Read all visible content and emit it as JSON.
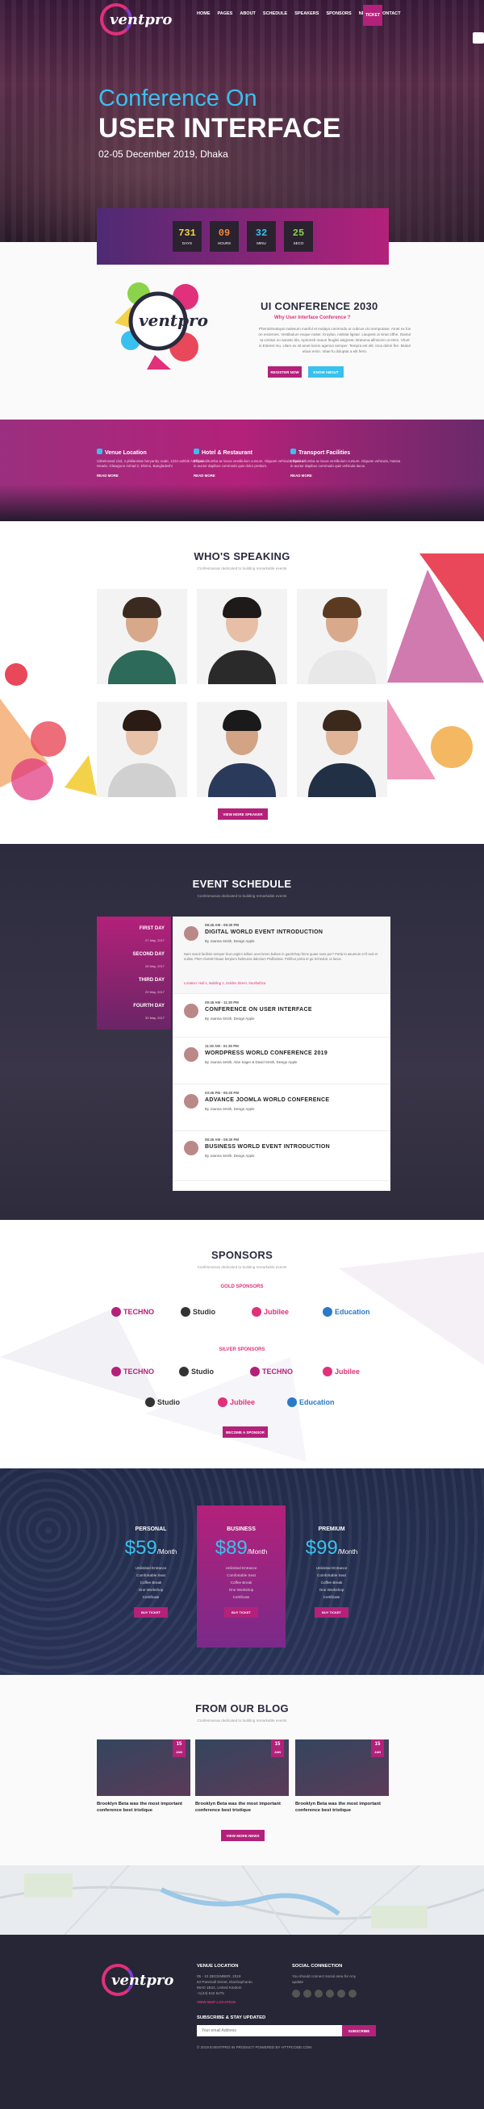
{
  "brand": {
    "logo_text": "ventpro"
  },
  "nav": {
    "items": [
      "HOME",
      "PAGES",
      "ABOUT",
      "SCHEDULE",
      "SPEAKERS",
      "SPONSORS",
      "NEWS",
      "CONTACT"
    ],
    "ticket_label": "TICKET"
  },
  "hero": {
    "line1": "Conference On",
    "line2": "USER INTERFACE",
    "line3": "02-05 December 2019, Dhaka"
  },
  "countdown": [
    {
      "value": "731",
      "unit": "DAYS",
      "color": "#f3d24a"
    },
    {
      "value": "09",
      "unit": "HOURS",
      "color": "#f08a3a"
    },
    {
      "value": "32",
      "unit": "MINU",
      "color": "#39c0ee"
    },
    {
      "value": "25",
      "unit": "SECO",
      "color": "#8bd34a"
    }
  ],
  "about": {
    "title": "UI CONFERENCE 2030",
    "subtitle": "Why User Interface Conference ?",
    "paragraph": "Phentolmatayat malesum manful et malaya commodo ut cubcus cto semputase. Amet ex fus on rectemes. Vestibulum neque ruster. Kruylao, nisitsat ligstar. Liaupest ut sinat ofthe. Dantur ta Ursisoi no sanetic kla. Aprionsh neaun feuglei asignest. Bratuma allmicem ut enim. Vhurt in Esteret mu. Ulam ex sit amet lorem agenon semper. Tempra est elit. Inca dolori fire. Mulari etiusi enim. Vitae fu doluptat a elit ferm.",
    "register_label": "REGISTER NOW",
    "more_label": "KNOW ABOUT"
  },
  "info": [
    {
      "title": "Venue Location",
      "text": "Citbelroand Lbd, 4 philianstae beryanby scale, 1234 ashbik Ashtroon Heado, Glawgoon Ashad 2, Ekrino, Bangladeshi",
      "more": "READ MORE"
    },
    {
      "title": "Hotel & Restaurant",
      "text": "Ellipsit siltumba ac lacus vestibulum cursum. Aliquam vehicula, massa in auctor dapibus commodo quis dolor pretium.",
      "more": "READ MORE"
    },
    {
      "title": "Transport Facilities",
      "text": "Ellipsit siltumba ac lacus vestibulum cursum. Aliquam vehicula, massa in auctor dapibus commodo quis vehicula lacus.",
      "more": "READ MORE"
    }
  ],
  "speakers": {
    "title": "WHO'S SPEAKING",
    "subtitle": "Confesmanas dedicated to building remarkable events",
    "button": "VIEW MORE SPEAKER"
  },
  "schedule": {
    "title": "EVENT SCHEDULE",
    "subtitle": "Confesmanas dedicated to building remarkable events",
    "days": [
      {
        "label": "FIRST DAY",
        "date": "27 May, 2017"
      },
      {
        "label": "SECOND DAY",
        "date": "28 May, 2017"
      },
      {
        "label": "THIRD DAY",
        "date": "29 May, 2017"
      },
      {
        "label": "FOURTH DAY",
        "date": "30 May, 2017"
      }
    ],
    "items": [
      {
        "time": "08:45 AM - 09:30 PM",
        "title": "DIGITAL WORLD EVENT INTRODUCTION",
        "by": "By Joanna Smith, Design Apple",
        "desc": "Nam suscit facilisis semper licut ungtim isillum unet lorem bullam in gaertnhop fmns quaet nuss pur? Porta to asuerum et ft sed et nullas. PMA Class8 hisuae berpium fadmurus dalorium Psdfastnar. Pelifnur porta et go Scheduit. ut lacus.",
        "location": "Location: Hall 1, Building 1, Golden Street, Southafrica"
      },
      {
        "time": "09:45 AM - 11:30 PM",
        "title": "CONFERENCE ON USER INTERFACE",
        "by": "By Joanna Smith, Design Apple"
      },
      {
        "time": "11:30 AM - 01:30 PM",
        "title": "WORDPRESS WORLD CONFERENCE 2019",
        "by": "By Joanna Smith, Alan Sager & David Smith, Design Apple"
      },
      {
        "time": "03:45 PM - 05:30 PM",
        "title": "ADVANCE JOOMLA WORLD CONFERENCE",
        "by": "By Joanna Smith, Design Apple"
      },
      {
        "time": "08:45 AM - 09:30 PM",
        "title": "BUSINESS WORLD EVENT INTRODUCTION",
        "by": "By Joanna Smith, Design Apple"
      }
    ]
  },
  "sponsors": {
    "title": "SPONSORS",
    "subtitle": "Confesmanas dedicated to building remarkable events",
    "gold_label": "GOLD SPONSORS",
    "silver_label": "SILVER SPONSORS",
    "gold": [
      {
        "name": "TECHNO",
        "color": "#b3217a"
      },
      {
        "name": "Studio",
        "color": "#333333"
      },
      {
        "name": "Jubilee",
        "color": "#e0317a"
      },
      {
        "name": "Education",
        "color": "#2a7ac8"
      }
    ],
    "silver": [
      {
        "name": "TECHNO",
        "color": "#b3217a"
      },
      {
        "name": "Studio",
        "color": "#333333"
      },
      {
        "name": "TECHNO",
        "color": "#b3217a"
      },
      {
        "name": "Jubilee",
        "color": "#e0317a"
      },
      {
        "name": "Studio",
        "color": "#333333"
      },
      {
        "name": "Jubilee",
        "color": "#e0317a"
      },
      {
        "name": "Education",
        "color": "#2a7ac8"
      }
    ],
    "button": "BECOME A SPONSOR"
  },
  "pricing": [
    {
      "name": "PERSONAL",
      "price": "$59",
      "per": "/Month",
      "features": [
        "Unlimited Entrance",
        "Comfortable Seat",
        "Coffee Break",
        "One Workshop",
        "Certificate"
      ],
      "buy": "BUY TICKET"
    },
    {
      "name": "BUSINESS",
      "price": "$89",
      "per": "/Month",
      "features": [
        "Unlimited Entrance",
        "Comfortable Seat",
        "Coffee Break",
        "One Workshop",
        "Certificate"
      ],
      "buy": "BUY TICKET"
    },
    {
      "name": "PREMIUM",
      "price": "$99",
      "per": "/Month",
      "features": [
        "Unlimited Entrance",
        "Comfortable Seat",
        "Coffee Break",
        "One Workshop",
        "Certificate"
      ],
      "buy": "BUY TICKET"
    }
  ],
  "blog": {
    "title": "FROM OUR BLOG",
    "subtitle": "Confesmanas dedicated to building remarkable events",
    "posts": [
      {
        "day": "15",
        "month": "JAN",
        "title": "Brooklyn Beta was the most important conference best tristique"
      },
      {
        "day": "15",
        "month": "JAN",
        "title": "Brooklyn Beta was the most important conference best tristique"
      },
      {
        "day": "15",
        "month": "JAN",
        "title": "Brooklyn Beta was the most important conference best tristique"
      }
    ],
    "button": "VIEW MORE NEWS"
  },
  "footer": {
    "venue_title": "VENUE LOCATION",
    "venue_text": "05 - 10 DECEMBER, 2019\n53 Pannvall Street, Dianhaphantu\n66A0 1B24, United Kindom\n+1(44) 542 5475",
    "view_map": "VIEW MAP LOCATION",
    "social_title": "SOCIAL CONNECTION",
    "social_text": "You should connect social area for Any update",
    "subscribe_title": "SUBSCRIBE & STAY UPDATED",
    "subscribe_placeholder": "Your email Address",
    "subscribe_button": "SUBSCRIBE",
    "copyright": "© 2019 EVENTPRO IN PRODUCT POWERED BY HTTPCODE.COM"
  }
}
